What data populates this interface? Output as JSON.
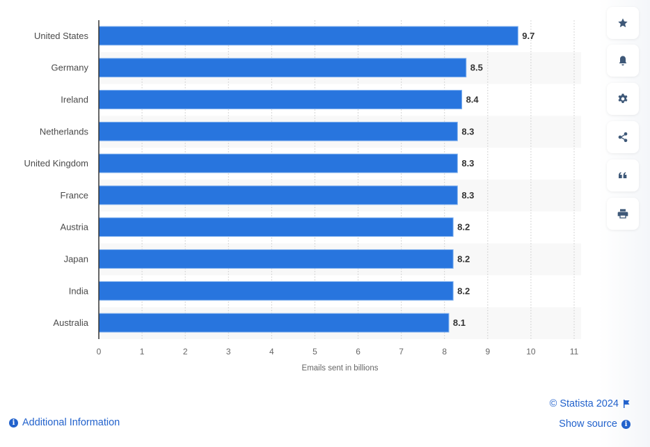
{
  "chart_data": {
    "type": "bar",
    "orientation": "horizontal",
    "categories": [
      "United States",
      "Germany",
      "Ireland",
      "Netherlands",
      "United Kingdom",
      "France",
      "Austria",
      "Japan",
      "India",
      "Australia"
    ],
    "values": [
      9.7,
      8.5,
      8.4,
      8.3,
      8.3,
      8.3,
      8.2,
      8.2,
      8.2,
      8.1
    ],
    "value_labels": [
      "9.7",
      "8.5",
      "8.4",
      "8.3",
      "8.3",
      "8.3",
      "8.2",
      "8.2",
      "8.2",
      "8.1"
    ],
    "title": "",
    "xlabel": "Emails sent in billions",
    "ylabel": "",
    "xlim": [
      0,
      11
    ],
    "xticks": [
      "0",
      "1",
      "2",
      "3",
      "4",
      "5",
      "6",
      "7",
      "8",
      "9",
      "10",
      "11"
    ],
    "grid": true,
    "legend": "none",
    "bar_color": "#2875de"
  },
  "toolbar": {
    "buttons": [
      {
        "name": "favorite-button",
        "icon": "star-icon"
      },
      {
        "name": "notification-button",
        "icon": "bell-icon"
      },
      {
        "name": "settings-button",
        "icon": "gear-icon"
      },
      {
        "name": "share-button",
        "icon": "share-icon"
      },
      {
        "name": "cite-button",
        "icon": "quote-icon"
      },
      {
        "name": "print-button",
        "icon": "print-icon"
      }
    ]
  },
  "footer": {
    "additional_info": "Additional Information",
    "copyright": "© Statista 2024",
    "show_source": "Show source",
    "info_glyph": "i"
  }
}
